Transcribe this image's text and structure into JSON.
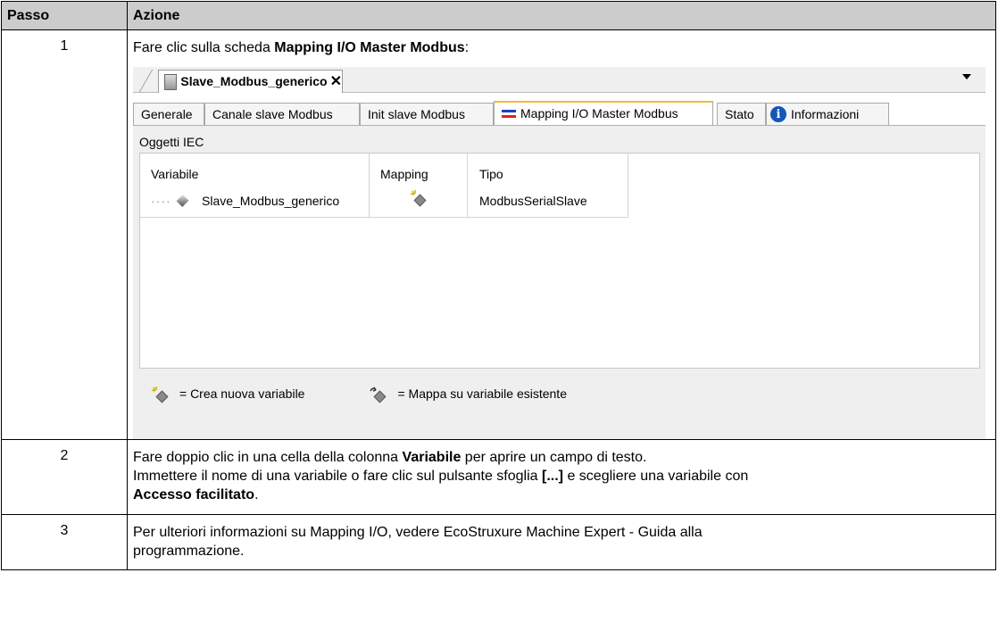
{
  "table": {
    "header": {
      "col1": "Passo",
      "col2": "Azione"
    },
    "rows": [
      {
        "num": "1",
        "text_before": "Fare clic sulla scheda ",
        "bold": "Mapping I/O Master Modbus",
        "text_after": ":"
      },
      {
        "num": "2",
        "line1_before": "Fare doppio clic in una cella della colonna ",
        "line1_bold": "Variabile",
        "line1_after": " per aprire un campo di testo.",
        "line2_before": "Immettere il nome di una variabile o fare clic sul pulsante sfoglia ",
        "line2_bold": "[...]",
        "line2_after": " e scegliere una variabile con",
        "line3_bold": "Accesso facilitato",
        "line3_after": "."
      },
      {
        "num": "3",
        "line1": "Per ulteriori informazioni su Mapping I/O, vedere EcoStruxure Machine Expert - Guida alla",
        "line2": "programmazione."
      }
    ]
  },
  "screenshot": {
    "doc_tab": "Slave_Modbus_generico",
    "close_glyph": "✕",
    "tabs": [
      "Generale",
      "Canale slave Modbus",
      "Init slave Modbus",
      "Mapping I/O Master Modbus",
      "Stato",
      "Informazioni"
    ],
    "active_tab": "Mapping I/O Master Modbus",
    "panel_title": "Oggetti IEC",
    "columns": [
      "Variabile",
      "Mapping",
      "Tipo"
    ],
    "row": {
      "tree": "····",
      "variable": "Slave_Modbus_generico",
      "type": "ModbusSerialSlave"
    },
    "legend": [
      "= Crea nuova variabile",
      "= Mappa su variabile esistente"
    ],
    "icons": [
      "device-icon",
      "close-icon",
      "dropdown-arrow-icon",
      "mapping-arrows-icon",
      "info-icon",
      "variable-cube-icon",
      "new-variable-icon",
      "map-existing-variable-icon"
    ],
    "accent_color": "#f1b93d"
  }
}
